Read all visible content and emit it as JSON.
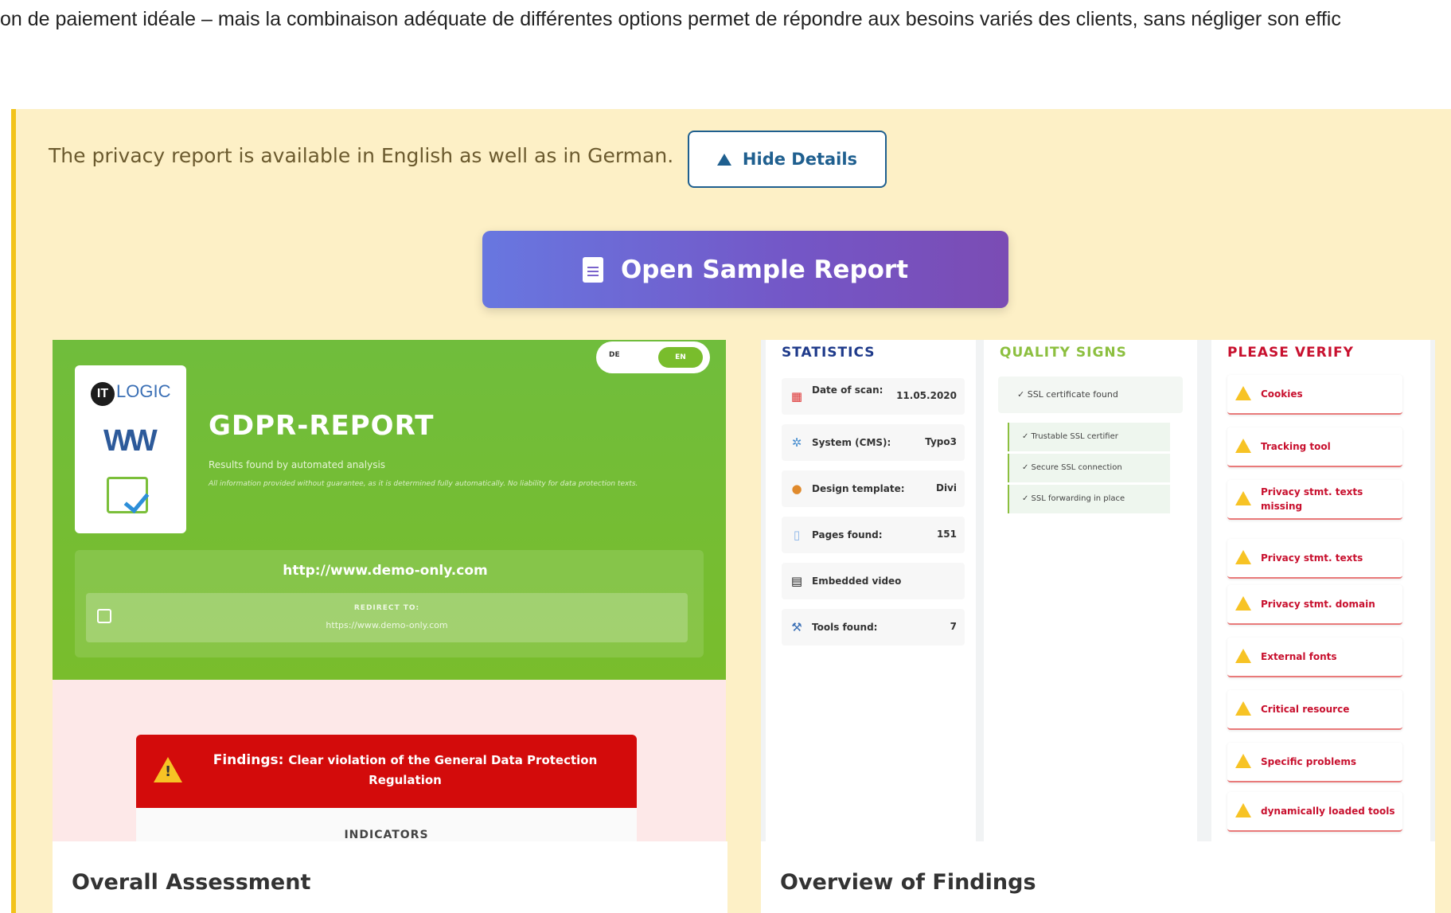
{
  "intro_text": "on de paiement idéale – mais la combinaison adéquate de différentes options permet de répondre aux besoins variés des clients, sans négliger son effic",
  "panel": {
    "privacy_text": "The privacy report is available in English as well as in German.",
    "hide_details_label": "Hide Details",
    "open_sample_label": "Open Sample Report"
  },
  "report_preview": {
    "logo_text": "LOGIC",
    "title": "GDPR-REPORT",
    "subtitle": "Results found by automated analysis",
    "disclaimer": "All information provided without guarantee, as it is determined fully automatically. No liability for data protection texts.",
    "lang_de": "DE",
    "lang_en": "EN",
    "url": "http://www.demo-only.com",
    "redirect_label": "REDIRECT TO:",
    "redirect_url": "https://www.demo-only.com",
    "findings_prefix": "Findings:",
    "findings_text": "Clear violation of the General Data Protection Regulation",
    "indicators_label": "INDICATORS"
  },
  "findings_preview": {
    "statistics_title": "STATISTICS",
    "quality_title": "QUALITY SIGNS",
    "verify_title": "PLEASE VERIFY",
    "statistics": [
      {
        "label": "Date of scan:",
        "value": "11.05.2020",
        "icon": "calendar-icon"
      },
      {
        "label": "System (CMS):",
        "value": "Typo3",
        "icon": "gear-icon"
      },
      {
        "label": "Design template:",
        "value": "Divi",
        "icon": "palette-icon"
      },
      {
        "label": "Pages found:",
        "value": "151",
        "icon": "page-icon"
      },
      {
        "label": "Embedded video",
        "value": "",
        "icon": "film-icon"
      },
      {
        "label": "Tools found:",
        "value": "7",
        "icon": "wrench-icon"
      }
    ],
    "quality_main": "✓  SSL certificate found",
    "quality_subs": [
      "✓  Trustable SSL certifier",
      "✓  Secure SSL connection",
      "✓  SSL forwarding in place"
    ],
    "verify_items": [
      "Cookies",
      "Tracking tool",
      "Privacy stmt. texts missing",
      "Privacy stmt. texts",
      "Privacy stmt. domain",
      "External fonts",
      "Critical resource",
      "Specific problems",
      "dynamically loaded tools"
    ]
  },
  "cards": {
    "left_title": "Overall Assessment",
    "right_title": "Overview of Findings"
  },
  "colors": {
    "panel_bg": "#fdf0c6",
    "panel_accent": "#f2c31b",
    "button_gradient_start": "#6877e0",
    "button_gradient_end": "#7b4cb4",
    "report_green": "#79bd2c",
    "findings_red": "#d30b0b"
  }
}
